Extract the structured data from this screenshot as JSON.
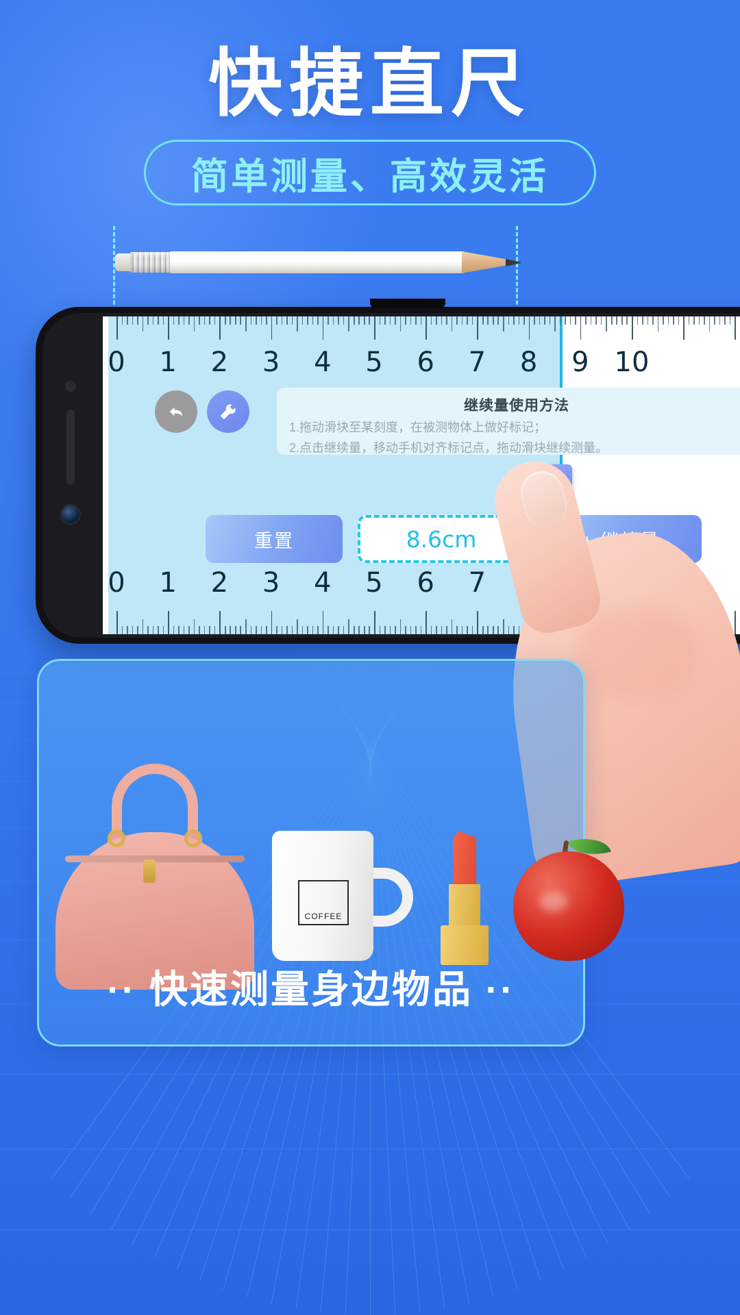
{
  "page": {
    "title": "快捷直尺",
    "subtitle": "简单测量、高效灵活",
    "bottom_caption": "·· 快速测量身边物品 ··"
  },
  "colors": {
    "background_blue": "#3a7bf0",
    "accent_cyan": "#8df0f7",
    "pill_border": "#6fe3ee",
    "ruler_fill": "#bfe7f7",
    "cursor_cyan": "#22b6e8",
    "value_text": "#22c0e5",
    "button_blue": "#7fa4f2",
    "card_border": "#7fd9f7"
  },
  "pencil": {
    "name": "pencil",
    "guide_left_label": "",
    "guide_right_label": ""
  },
  "phone": {
    "screen": {
      "ruler": {
        "unit": "cm",
        "numbers": [
          0,
          1,
          2,
          3,
          4,
          5,
          6,
          7,
          8,
          9,
          10
        ],
        "measured_value": 8.6,
        "max": 10
      },
      "icons": {
        "back": "back-arrow-icon",
        "tool": "wrench-icon"
      },
      "tooltip": {
        "title": "继续量使用方法",
        "lines": [
          "1.拖动滑块至某刻度，在被测物体上做好标记；",
          "2.点击继续量，移动手机对齐标记点，拖动滑块继续测量。"
        ]
      },
      "actions": {
        "reset_label": "重置",
        "value_label": "8.6cm",
        "continue_label": "+ 继续量"
      }
    }
  },
  "products": [
    {
      "name": "handbag",
      "label": ""
    },
    {
      "name": "coffee-mug",
      "label": "COFFEE"
    },
    {
      "name": "lipstick",
      "label": ""
    },
    {
      "name": "apple",
      "label": ""
    }
  ]
}
